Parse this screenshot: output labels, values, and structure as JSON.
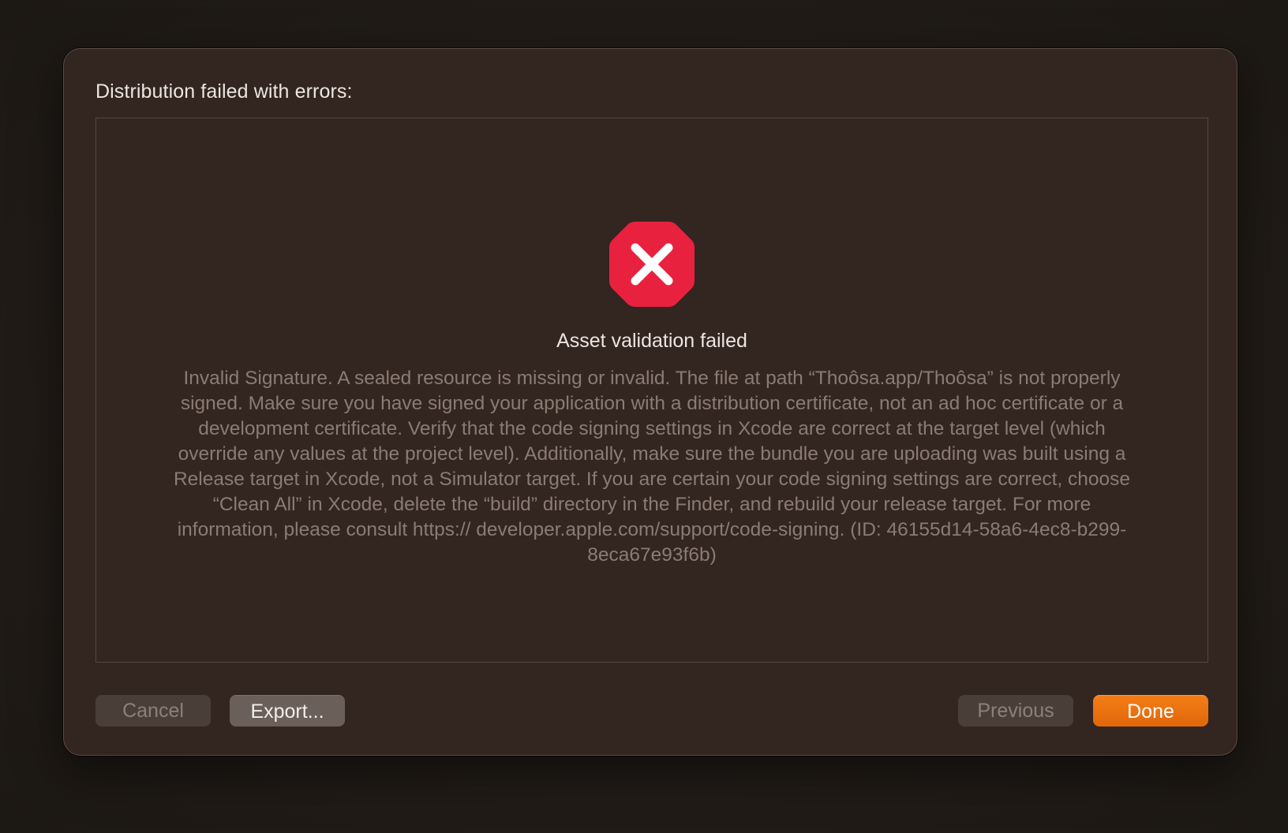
{
  "dialog": {
    "heading": "Distribution failed with errors:",
    "error": {
      "icon": "error-octagon-icon",
      "icon_color": "#e8213f",
      "title": "Asset validation failed",
      "message": "Invalid Signature. A sealed resource is missing or invalid. The file at path “Thoôsa.app/Thoôsa” is not properly signed. Make sure you have signed your application with a distribution certificate, not an ad hoc certificate or a development certificate. Verify that the code signing settings in Xcode are correct at the target level (which override any values at the project level). Additionally, make sure the bundle you are uploading was built using a Release target in Xcode, not a Simulator target. If you are certain your code signing settings are correct, choose “Clean All” in Xcode, delete the “build” directory in the Finder, and rebuild your release target. For more information, please consult https:// developer.apple.com/support/code-signing. (ID: 46155d14-58a6-4ec8-b299-8eca67e93f6b)"
    },
    "buttons": {
      "cancel": "Cancel",
      "export": "Export...",
      "previous": "Previous",
      "done": "Done"
    },
    "accent_color": "#f07412"
  }
}
